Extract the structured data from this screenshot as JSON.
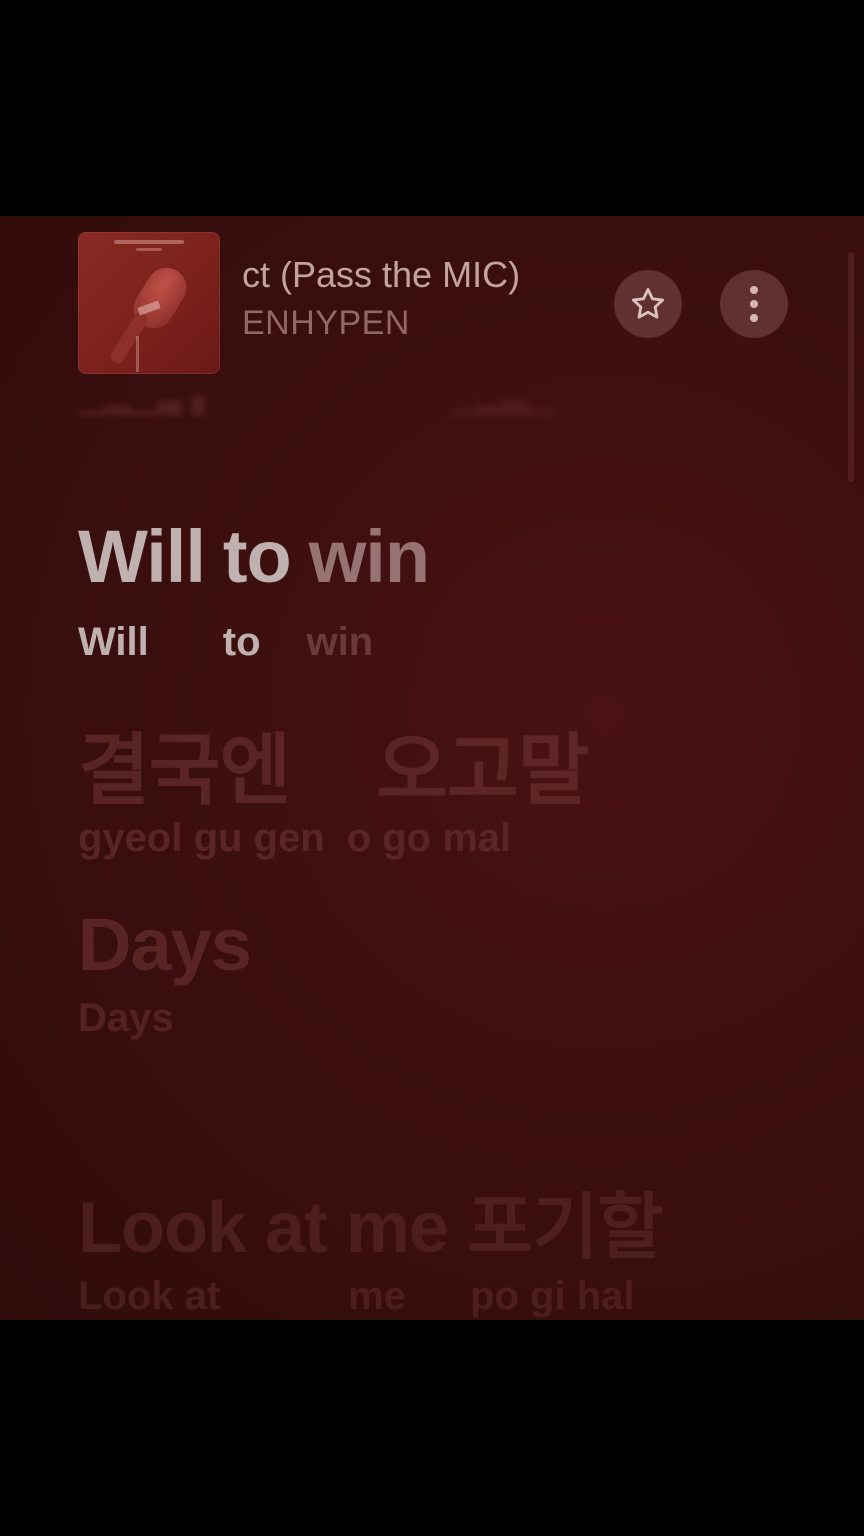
{
  "now_playing": {
    "title": "ct (Pass the MIC)",
    "artist": "ENHYPEN",
    "album_art_icon": "microphone-album-art"
  },
  "controls": {
    "favorite_icon": "star-icon",
    "more_icon": "more-vertical-icon"
  },
  "lyrics": {
    "active": {
      "main": [
        "Will",
        "to",
        "win"
      ],
      "romanized": [
        "Will",
        "to",
        "win"
      ]
    },
    "line2": {
      "main": [
        "결국엔",
        "오고말"
      ],
      "romanized": [
        "gyeol gu gen",
        "o go mal"
      ]
    },
    "line3": {
      "main": "Days",
      "romanized": "Days"
    },
    "line4": {
      "main": "Look at me 포기할",
      "romanized": [
        "Look at",
        "me",
        "po gi hal"
      ]
    }
  },
  "colors": {
    "background": "#3d0f0f",
    "active_text": "#d2c8c6",
    "inactive_text": "#6e3434"
  }
}
